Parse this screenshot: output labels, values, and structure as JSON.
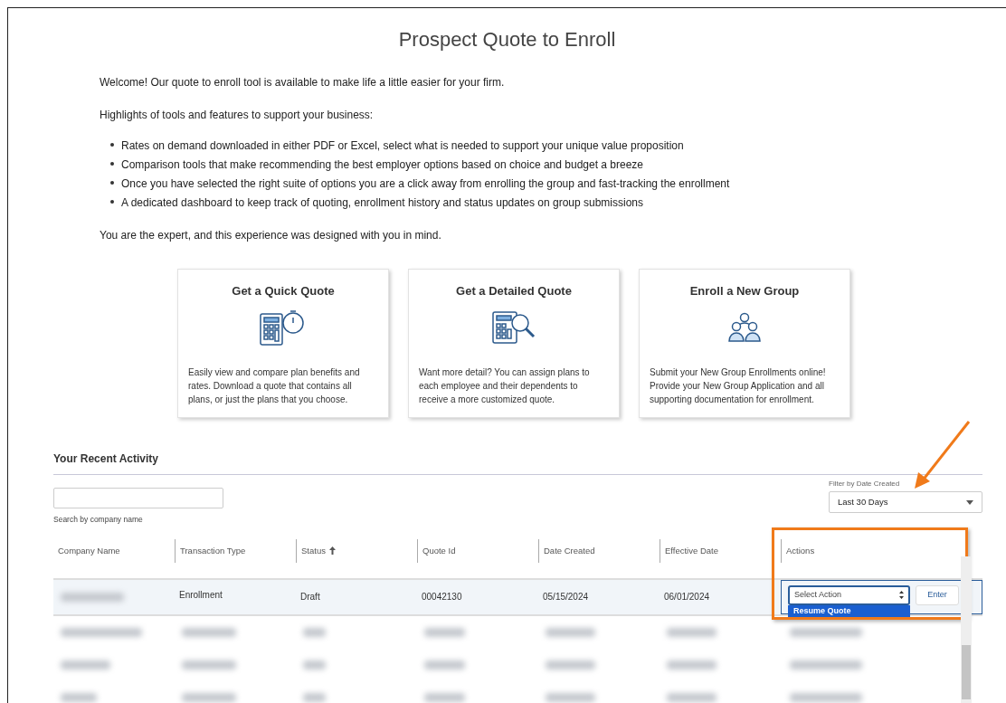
{
  "title": "Prospect Quote to Enroll",
  "intro": "Welcome! Our quote to enroll tool is available to make life a little easier for your firm.",
  "highlights_heading": "Highlights of tools and features to support your business:",
  "highlights": [
    "Rates on demand downloaded in either PDF or Excel, select what is needed to support your unique value proposition",
    "Comparison tools that make recommending the best employer options based on choice and budget a breeze",
    "Once you have selected the right suite of options you are a click away from enrolling the group and fast-tracking the enrollment",
    "A dedicated dashboard to keep track of quoting, enrollment history and status updates on group submissions"
  ],
  "closing": "You are the expert, and this experience was designed with you in mind.",
  "cards": [
    {
      "kind": "quick",
      "title": "Get a Quick Quote",
      "text": "Easily view and compare plan benefits and rates. Download a quote that contains all plans, or just the plans that you choose."
    },
    {
      "kind": "detailed",
      "title": "Get a Detailed Quote",
      "text": "Want more detail? You can assign plans to each employee and their dependents to receive a more customized quote."
    },
    {
      "kind": "group",
      "title": "Enroll a New Group",
      "text": "Submit your New Group Enrollments online! Provide your New Group Application and all supporting documentation for enrollment."
    }
  ],
  "activity": {
    "heading": "Your Recent Activity",
    "search_hint": "Search by company name",
    "filter_label": "Filter by Date Created",
    "filter_value": "Last 30 Days",
    "columns": [
      {
        "label": "Company Name",
        "sorted": false
      },
      {
        "label": "Transaction Type",
        "sorted": false
      },
      {
        "label": "Status",
        "sorted": true
      },
      {
        "label": "Quote Id",
        "sorted": false
      },
      {
        "label": "Date Created",
        "sorted": false
      },
      {
        "label": "Effective Date",
        "sorted": false
      },
      {
        "label": "Actions",
        "sorted": false
      }
    ],
    "row": {
      "transaction_type": "Enrollment",
      "status": "Draft",
      "quote_id": "00042130",
      "date_created": "05/15/2024",
      "effective_date": "06/01/2024",
      "action_select": "Select Action",
      "action_option": "Resume Quote",
      "enter": "Enter"
    }
  }
}
